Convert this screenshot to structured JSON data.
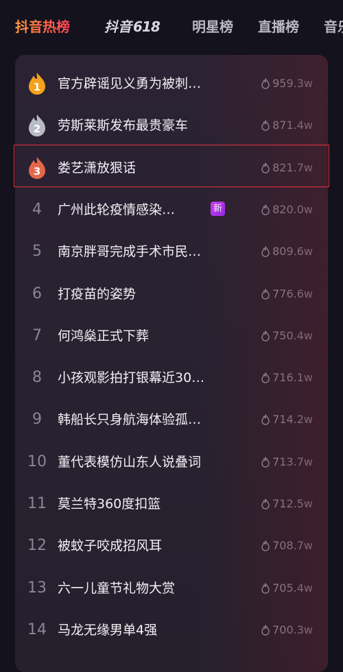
{
  "tabs": [
    {
      "label": "抖音热榜",
      "active": true,
      "icon": null
    },
    {
      "label": "抖音",
      "brand_suffix": "618",
      "active": false,
      "icon": "douyin-618-logo"
    },
    {
      "label": "明星榜",
      "active": false,
      "icon": null
    },
    {
      "label": "直播榜",
      "active": false,
      "icon": null
    },
    {
      "label": "音乐",
      "active": false,
      "icon": null
    }
  ],
  "hot_list": {
    "items": [
      {
        "rank": "1",
        "title": "官方辟谣见义勇为被刺…",
        "heat": "959.3w",
        "badge": null,
        "medal": "gold"
      },
      {
        "rank": "2",
        "title": "劳斯莱斯发布最贵豪车",
        "heat": "871.4w",
        "badge": null,
        "medal": "silver"
      },
      {
        "rank": "3",
        "title": "娄艺潇放狠话",
        "heat": "821.7w",
        "badge": null,
        "medal": "bronze"
      },
      {
        "rank": "4",
        "title": "广州此轮疫情感染…",
        "heat": "820.0w",
        "badge": "新",
        "medal": null
      },
      {
        "rank": "5",
        "title": "南京胖哥完成手术市民…",
        "heat": "809.6w",
        "badge": null,
        "medal": null
      },
      {
        "rank": "6",
        "title": "打疫苗的姿势",
        "heat": "776.6w",
        "badge": null,
        "medal": null
      },
      {
        "rank": "7",
        "title": "何鸿燊正式下葬",
        "heat": "750.4w",
        "badge": null,
        "medal": null
      },
      {
        "rank": "8",
        "title": "小孩观影拍打银幕近30…",
        "heat": "716.1w",
        "badge": null,
        "medal": null
      },
      {
        "rank": "9",
        "title": "韩船长只身航海体验孤…",
        "heat": "714.2w",
        "badge": null,
        "medal": null
      },
      {
        "rank": "10",
        "title": "董代表模仿山东人说叠词",
        "heat": "713.7w",
        "badge": null,
        "medal": null
      },
      {
        "rank": "11",
        "title": "莫兰特360度扣篮",
        "heat": "712.5w",
        "badge": null,
        "medal": null
      },
      {
        "rank": "12",
        "title": "被蚊子咬成招风耳",
        "heat": "708.7w",
        "badge": null,
        "medal": null
      },
      {
        "rank": "13",
        "title": "六一儿童节礼物大赏",
        "heat": "705.4w",
        "badge": null,
        "medal": null
      },
      {
        "rank": "14",
        "title": "马龙无缘男单4强",
        "heat": "700.3w",
        "badge": null,
        "medal": null
      }
    ]
  },
  "colors": {
    "background": "#14121c",
    "panel": "#2b2333",
    "accent_start": "#ff9a3c",
    "accent_end": "#ff3f56",
    "medal_gold": "#f6a21c",
    "medal_silver": "#b9bcc6",
    "medal_bronze": "#e5674a",
    "new_badge": "#c637ff",
    "highlight_border": "#e8323c"
  },
  "icons": {
    "heat_icon": "flame-icon",
    "medal_icon": "flame-medal-icon"
  }
}
